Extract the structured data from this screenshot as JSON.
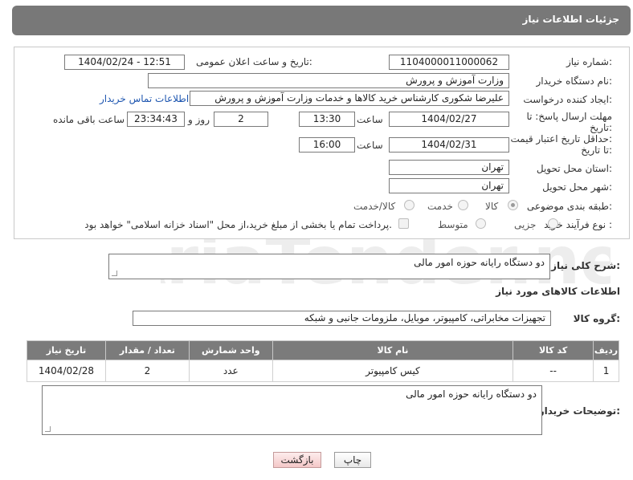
{
  "header": {
    "title": "جزئیات اطلاعات نیاز"
  },
  "form": {
    "need_number_label": "شماره نیاز:",
    "need_number": "1104000011000062",
    "announce_label": "تاریخ و ساعت اعلان عمومی:",
    "announce_value": "1404/02/24 - 12:51",
    "buyer_org_label": "نام دستگاه خریدار:",
    "buyer_org": "وزارت آموزش و پرورش",
    "creator_label": "ایجاد کننده درخواست:",
    "creator": "علیرضا شکوری کارشناس خرید کالاها و خدمات وزارت آموزش و پرورش",
    "contact_link": "اطلاعات تماس خریدار",
    "deadline_label_1": "مهلت ارسال پاسخ: تا",
    "deadline_label_2": "تاریخ:",
    "deadline_date": "1404/02/27",
    "time_label": "ساعت",
    "deadline_time": "13:30",
    "days_value": "2",
    "days_label": "روز و",
    "remaining_value": "23:34:43",
    "remaining_label": "ساعت باقی مانده",
    "price_label_1": "حداقل تاریخ اعتبار قیمت:",
    "price_label_2": "تا تاریخ:",
    "price_date": "1404/02/31",
    "price_time": "16:00",
    "province_label": "استان محل تحویل:",
    "province": "تهران",
    "city_label": "شهر محل تحویل:",
    "city": "تهران",
    "category_label": "طبقه بندی موضوعی:",
    "category_options": [
      "کالا",
      "خدمت",
      "کالا/خدمت"
    ],
    "process_label": "نوع فرآیند خرید :",
    "process_options": [
      "جزیی",
      "متوسط"
    ],
    "payment_note": "پرداخت تمام یا بخشی از مبلغ خرید،از محل \"اسناد خزانه اسلامی\" خواهد بود."
  },
  "summary": {
    "label": "شرح کلی نیاز:",
    "value": "دو دستگاه رایانه حوزه امور مالی"
  },
  "goods": {
    "section_title": "اطلاعات کالاهای مورد نیاز",
    "group_label": "گروه کالا:",
    "group_value": "تجهیزات مخابراتی، کامپیوتر، موبایل، ملزومات جانبی و شبکه",
    "columns": [
      "ردیف",
      "کد کالا",
      "نام کالا",
      "واحد شمارش",
      "تعداد / مقدار",
      "تاریخ نیاز"
    ],
    "rows": [
      {
        "row": "1",
        "code": "--",
        "name": "کیس کامپیوتر",
        "unit": "عدد",
        "qty": "2",
        "date": "1404/02/28"
      }
    ]
  },
  "buyer_notes": {
    "label": "توضیحات خریدار:",
    "value": "دو دستگاه رایانه حوزه امور مالی"
  },
  "actions": {
    "print": "چاپ",
    "back": "بازگشت"
  },
  "watermark": {
    "text": "AriaTender.net"
  }
}
